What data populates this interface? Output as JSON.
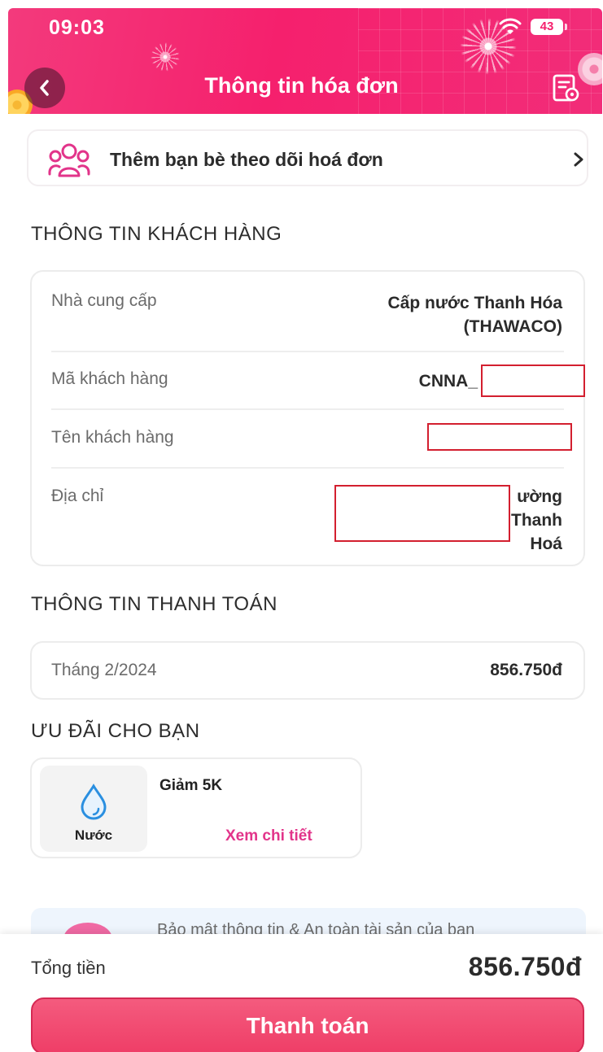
{
  "status_bar": {
    "time": "09:03",
    "battery": "43"
  },
  "header": {
    "title": "Thông tin hóa đơn"
  },
  "follow": {
    "label": "Thêm bạn bè theo dõi hoá đơn"
  },
  "customer_section": {
    "title": "THÔNG TIN KHÁCH HÀNG",
    "rows": [
      {
        "label": "Nhà cung cấp",
        "value_line1": "Cấp nước Thanh Hóa",
        "value_line2": "(THAWACO)"
      },
      {
        "label": "Mã khách hàng",
        "value": "CNNA_"
      },
      {
        "label": "Tên khách hàng",
        "value": ""
      },
      {
        "label": "Địa chỉ",
        "value_line1": "ường",
        "value_line2": "Thanh",
        "value_line3": "Hoá"
      }
    ]
  },
  "payment_section": {
    "title": "THÔNG TIN THANH TOÁN",
    "month": "Tháng 2/2024",
    "amount": "856.750đ"
  },
  "promo_section": {
    "title": "ƯU ĐÃI CHO BẠN",
    "thumb_label": "Nước",
    "offer": "Giảm 5K",
    "link": "Xem chi tiết"
  },
  "security_banner": {
    "text": "Bảo mật thông tin & An toàn tài sản của bạn"
  },
  "footer": {
    "total_label": "Tổng tiền",
    "total_value": "856.750đ",
    "pay_button": "Thanh toán"
  },
  "colors": {
    "brand": "#f5206d",
    "accent_link": "#e2348a",
    "pay_button": "#ef3e67"
  }
}
